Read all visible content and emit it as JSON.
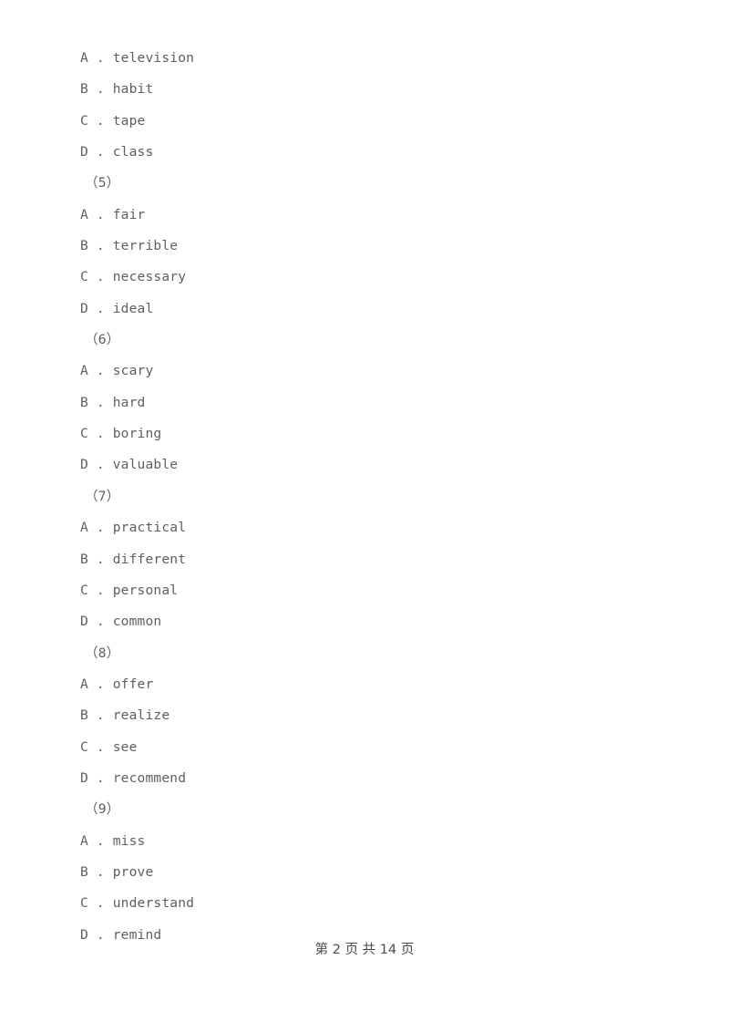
{
  "document": {
    "background_color": "#ffffff",
    "text_color": "#5f5f5f",
    "footer_color": "#4a4a4a"
  },
  "lines": [
    {
      "kind": "option",
      "text": "A . television"
    },
    {
      "kind": "option",
      "text": "B . habit"
    },
    {
      "kind": "option",
      "text": "C . tape"
    },
    {
      "kind": "option",
      "text": "D . class"
    },
    {
      "kind": "qnum",
      "text": "（5）"
    },
    {
      "kind": "option",
      "text": "A . fair"
    },
    {
      "kind": "option",
      "text": "B . terrible"
    },
    {
      "kind": "option",
      "text": "C . necessary"
    },
    {
      "kind": "option",
      "text": "D . ideal"
    },
    {
      "kind": "qnum",
      "text": "（6）"
    },
    {
      "kind": "option",
      "text": "A . scary"
    },
    {
      "kind": "option",
      "text": "B . hard"
    },
    {
      "kind": "option",
      "text": "C . boring"
    },
    {
      "kind": "option",
      "text": "D . valuable"
    },
    {
      "kind": "qnum",
      "text": "（7）"
    },
    {
      "kind": "option",
      "text": "A . practical"
    },
    {
      "kind": "option",
      "text": "B . different"
    },
    {
      "kind": "option",
      "text": "C . personal"
    },
    {
      "kind": "option",
      "text": "D . common"
    },
    {
      "kind": "qnum",
      "text": "（8）"
    },
    {
      "kind": "option",
      "text": "A . offer"
    },
    {
      "kind": "option",
      "text": "B . realize"
    },
    {
      "kind": "option",
      "text": "C . see"
    },
    {
      "kind": "option",
      "text": "D . recommend"
    },
    {
      "kind": "qnum",
      "text": "（9）"
    },
    {
      "kind": "option",
      "text": "A . miss"
    },
    {
      "kind": "option",
      "text": "B . prove"
    },
    {
      "kind": "option",
      "text": "C . understand"
    },
    {
      "kind": "option",
      "text": "D . remind"
    }
  ],
  "footer": {
    "text": "第 2 页 共 14 页",
    "current_page": "2",
    "total_pages": "14"
  }
}
